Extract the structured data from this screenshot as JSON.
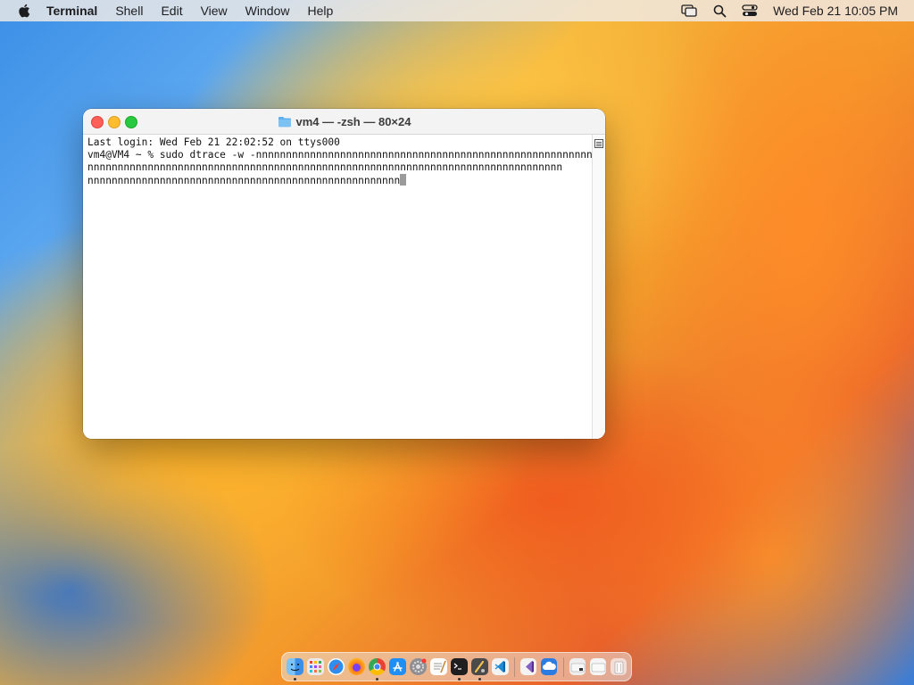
{
  "menubar": {
    "apple_icon": "apple-logo-icon",
    "app_name": "Terminal",
    "menus": [
      "Shell",
      "Edit",
      "View",
      "Window",
      "Help"
    ],
    "status_icons": [
      "screen-mirroring-icon",
      "search-icon",
      "control-center-icon"
    ],
    "clock": "Wed Feb 21  10:05 PM"
  },
  "window": {
    "title": "vm4 — -zsh — 80×24",
    "title_icon": "folder-icon",
    "lines": [
      "Last login: Wed Feb 21 22:02:52 on ttys000",
      "vm4@VM4 ~ % sudo dtrace -w -nnnnnnnnnnnnnnnnnnnnnnnnnnnnnnnnnnnnnnnnnnnnnnnnnnnnnnnnnnn",
      "nnnnnnnnnnnnnnnnnnnnnnnnnnnnnnnnnnnnnnnnnnnnnnnnnnnnnnnnnnnnnnnnnnnnnnnnnnnnnnn",
      "nnnnnnnnnnnnnnnnnnnnnnnnnnnnnnnnnnnnnnnnnnnnnnnnnnnn"
    ],
    "colors": {
      "close": "#fe5f57",
      "minimize": "#febc2e",
      "zoom": "#28c840"
    }
  },
  "dock": {
    "apps": [
      {
        "name": "Finder",
        "icon": "finder-icon",
        "running": true
      },
      {
        "name": "Launchpad",
        "icon": "launchpad-icon",
        "running": false
      },
      {
        "name": "Safari",
        "icon": "safari-icon",
        "running": false
      },
      {
        "name": "Firefox",
        "icon": "firefox-icon",
        "running": false
      },
      {
        "name": "Google Chrome",
        "icon": "chrome-icon",
        "running": true
      },
      {
        "name": "App Store",
        "icon": "app-store-icon",
        "running": false
      },
      {
        "name": "System Settings",
        "icon": "settings-icon",
        "running": false
      },
      {
        "name": "TextEdit",
        "icon": "textedit-icon",
        "running": false
      },
      {
        "name": "Terminal",
        "icon": "terminal-icon",
        "running": true
      },
      {
        "name": "Script Editor",
        "icon": "script-editor-icon",
        "running": true
      },
      {
        "name": "Visual Studio Code",
        "icon": "vscode-icon",
        "running": false
      },
      {
        "name": "Visual Studio",
        "icon": "visual-studio-icon",
        "running": false
      },
      {
        "name": "Cloud",
        "icon": "cloud-icon",
        "running": false
      },
      {
        "name": "Downloads",
        "icon": "downloads-folder-icon",
        "running": false
      },
      {
        "name": "Documents",
        "icon": "documents-folder-icon",
        "running": false
      },
      {
        "name": "Trash",
        "icon": "trash-icon",
        "running": false
      }
    ]
  }
}
